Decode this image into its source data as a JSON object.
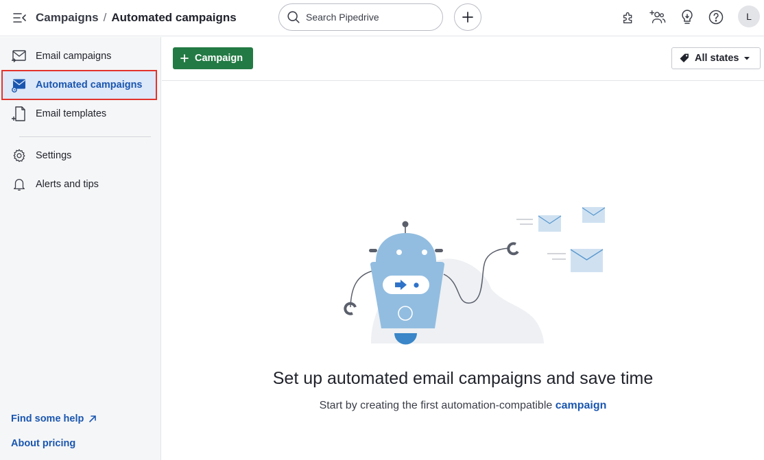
{
  "header": {
    "breadcrumb_parent": "Campaigns",
    "breadcrumb_separator": "/",
    "breadcrumb_current": "Automated campaigns",
    "search_placeholder": "Search Pipedrive",
    "avatar_initial": "L",
    "icons": [
      "menu-collapse-icon",
      "search-icon",
      "plus-icon",
      "puzzle-icon",
      "add-contacts-icon",
      "lightbulb-icon",
      "help-icon"
    ]
  },
  "sidebar": {
    "items": [
      {
        "label": "Email campaigns",
        "icon": "email-campaign-icon"
      },
      {
        "label": "Automated campaigns",
        "icon": "automated-campaign-icon",
        "active": true
      },
      {
        "label": "Email templates",
        "icon": "email-template-icon"
      },
      {
        "label": "Settings",
        "icon": "gear-icon"
      },
      {
        "label": "Alerts and tips",
        "icon": "bell-icon"
      }
    ],
    "links": {
      "help": "Find some help",
      "pricing": "About pricing"
    }
  },
  "toolbar": {
    "campaign_button": "Campaign",
    "states_filter": "All states"
  },
  "empty_state": {
    "title": "Set up automated email campaigns and save time",
    "subtitle_prefix": "Start by creating the first automation-compatible",
    "subtitle_link": "campaign"
  },
  "colors": {
    "accent_blue": "#1a56b0",
    "primary_green": "#237a44",
    "active_bg": "#dde8f8",
    "highlight_red": "#e3322b"
  }
}
